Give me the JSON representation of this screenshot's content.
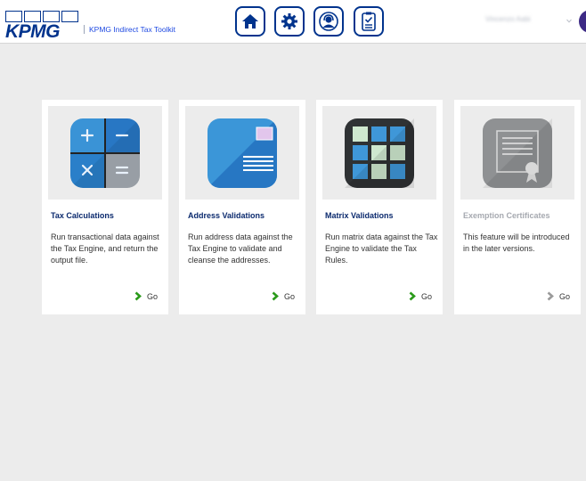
{
  "header": {
    "logo_text": "KPMG",
    "app_title": "KPMG Indirect Tax Toolkit",
    "user_name": "Vincenzo Aabi"
  },
  "nav": [
    {
      "icon": "home-icon"
    },
    {
      "icon": "gear-icon"
    },
    {
      "icon": "support-icon"
    },
    {
      "icon": "checklist-icon"
    }
  ],
  "cards": [
    {
      "title": "Tax Calculations",
      "description": "Run transactional data against the Tax Engine, and return the output file.",
      "go_label": "Go",
      "enabled": true,
      "icon": "calculator-icon"
    },
    {
      "title": "Address Validations",
      "description": "Run address data against the Tax Engine to validate and cleanse the addresses.",
      "go_label": "Go",
      "enabled": true,
      "icon": "address-card-icon"
    },
    {
      "title": "Matrix Validations",
      "description": "Run matrix data against the Tax Engine to validate the Tax Rules.",
      "go_label": "Go",
      "enabled": true,
      "icon": "matrix-grid-icon"
    },
    {
      "title": "Exemption Certificates",
      "description": "This feature will be introduced in the later versions.",
      "go_label": "Go",
      "enabled": false,
      "icon": "certificate-icon"
    }
  ],
  "colors": {
    "brand_blue": "#00338d",
    "go_green": "#2a9a1a",
    "go_disabled": "#9a9a9a",
    "background": "#ececec"
  }
}
